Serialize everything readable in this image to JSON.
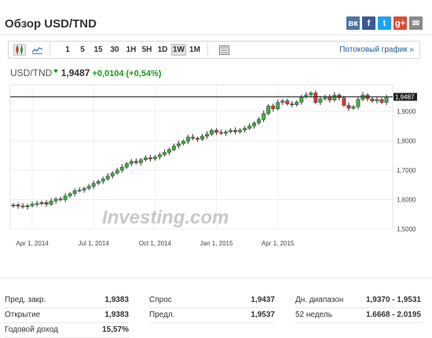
{
  "header": {
    "title": "Обзор USD/TND"
  },
  "share": [
    {
      "name": "vk-icon",
      "glyph": "вк",
      "color": "#4c75a3"
    },
    {
      "name": "facebook-icon",
      "glyph": "f",
      "color": "#3b5998"
    },
    {
      "name": "twitter-icon",
      "glyph": "t",
      "color": "#1da1f2"
    },
    {
      "name": "googleplus-icon",
      "glyph": "g+",
      "color": "#dd4b39"
    },
    {
      "name": "email-icon",
      "glyph": "✉",
      "color": "#8a8a8a"
    }
  ],
  "toolbar": {
    "timeframes": [
      "1",
      "5",
      "15",
      "30",
      "1H",
      "5H",
      "1D",
      "1W",
      "1M"
    ],
    "active": "1W",
    "stream_label": "Потоковый график »"
  },
  "quote": {
    "pair": "USD/TND",
    "price": "1,9487",
    "change": "+0,0104",
    "change_pct": "(+0,54%)",
    "arrow": "◆"
  },
  "chart_data": {
    "type": "candlestick",
    "x_labels": [
      "Apr 1, 2014",
      "Jul 1, 2014",
      "Oct 1, 2014",
      "Jan 1, 2015",
      "Apr 1, 2015"
    ],
    "y_ticks": [
      "1,9000",
      "1,8000",
      "1,7000",
      "1,6000",
      "1,5000"
    ],
    "ylim": [
      1.5,
      1.99
    ],
    "current_price_label": "1,9487",
    "current_price": 1.9487,
    "watermark": "Investing.com",
    "close": [
      1.582,
      1.578,
      1.575,
      1.579,
      1.585,
      1.586,
      1.59,
      1.584,
      1.595,
      1.602,
      1.6,
      1.612,
      1.62,
      1.63,
      1.632,
      1.638,
      1.645,
      1.655,
      1.662,
      1.67,
      1.68,
      1.69,
      1.7,
      1.71,
      1.722,
      1.73,
      1.725,
      1.735,
      1.742,
      1.738,
      1.745,
      1.752,
      1.76,
      1.77,
      1.782,
      1.79,
      1.798,
      1.812,
      1.808,
      1.805,
      1.815,
      1.822,
      1.835,
      1.828,
      1.825,
      1.83,
      1.835,
      1.83,
      1.836,
      1.842,
      1.85,
      1.86,
      1.872,
      1.892,
      1.918,
      1.908,
      1.93,
      1.935,
      1.925,
      1.922,
      1.931,
      1.948,
      1.955,
      1.962,
      1.93,
      1.942,
      1.95,
      1.938,
      1.955,
      1.945,
      1.92,
      1.91,
      1.915,
      1.94,
      1.955,
      1.942,
      1.935,
      1.94,
      1.93,
      1.948
    ]
  },
  "stats": {
    "col1": [
      {
        "label": "Пред. закр.",
        "value": "1,9383"
      },
      {
        "label": "Открытие",
        "value": "1,9383"
      },
      {
        "label": "Годовой доход",
        "value": "15,57%"
      }
    ],
    "col2": [
      {
        "label": "Спрос",
        "value": "1,9437"
      },
      {
        "label": "Предл.",
        "value": "1,9537"
      }
    ],
    "col3": [
      {
        "label": "Дн. диапазон",
        "value": "1,9370 - 1,9531"
      },
      {
        "label": "52 недель",
        "value": "1.6668 - 2.0195"
      }
    ]
  }
}
